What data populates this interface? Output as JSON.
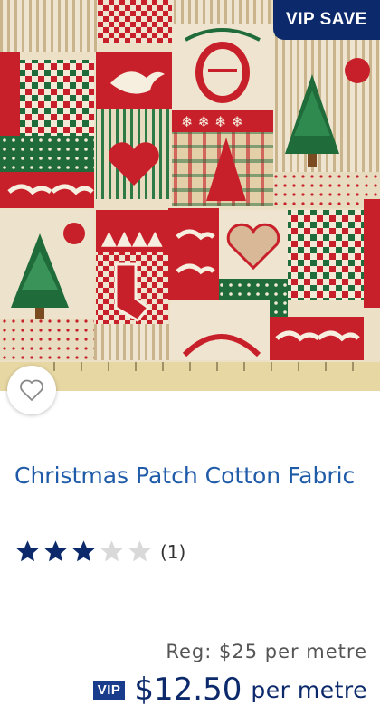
{
  "product": {
    "image_alt": "Christmas patchwork cotton fabric with trees, doves, hearts and stockings",
    "badge": "VIP SAVE",
    "title": "Christmas Patch Cotton Fabric",
    "rating": {
      "value": 3,
      "max": 5,
      "count_label": "(1)"
    },
    "regular_price": "Reg: $25 per metre",
    "vip": {
      "tag": "VIP",
      "price": "$12.50",
      "unit": "per metre"
    }
  },
  "colors": {
    "title_blue": "#1f5ba8",
    "navy": "#0c2a6b",
    "star_filled": "#0c2a6b",
    "star_empty": "#d9d9d9",
    "fabric_red": "#c8202a",
    "fabric_green": "#1f6b3a",
    "fabric_cream": "#ece0c6"
  },
  "icons": {
    "wishlist": "heart-outline-icon",
    "star": "star-icon"
  }
}
